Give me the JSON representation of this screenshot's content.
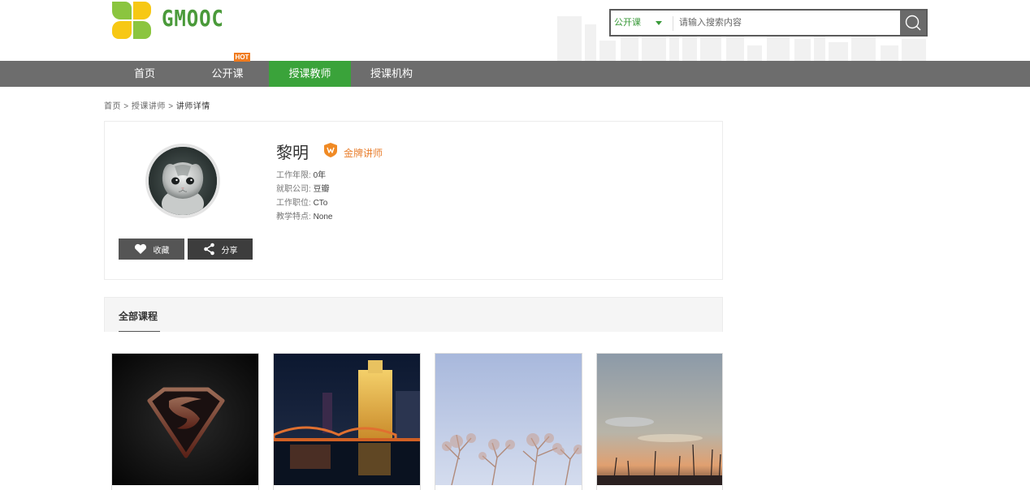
{
  "logo": {
    "text": "GMOOC"
  },
  "search": {
    "type": "公开课",
    "placeholder": "请输入搜索内容"
  },
  "nav": {
    "items": [
      {
        "label": "首页"
      },
      {
        "label": "公开课"
      },
      {
        "label": "授课教师"
      },
      {
        "label": "授课机构"
      }
    ],
    "hot_badge": "HOT",
    "active_index": 2
  },
  "breadcrumb": {
    "home": "首页",
    "sep": ">",
    "teachers": "授课讲师",
    "current": "讲师详情"
  },
  "teacher": {
    "name": "黎明",
    "badge": "金牌讲师",
    "info": [
      {
        "label": "工作年限:",
        "value": "0年"
      },
      {
        "label": "就职公司:",
        "value": "豆瓣"
      },
      {
        "label": "工作职位:",
        "value": "CTo"
      },
      {
        "label": "教学特点:",
        "value": "None"
      }
    ],
    "favorite_label": "收藏",
    "share_label": "分享"
  },
  "courses": {
    "tab_label": "全部课程"
  },
  "colors": {
    "nav_bg": "#6d6d6d",
    "nav_active": "#3aa33a",
    "accent_orange": "#e97f2e",
    "brand_green": "#4a9a3a"
  },
  "icons": [
    "clover-logo-icon",
    "search-icon",
    "chevron-down-icon",
    "heart-icon",
    "share-icon",
    "medal-icon"
  ]
}
